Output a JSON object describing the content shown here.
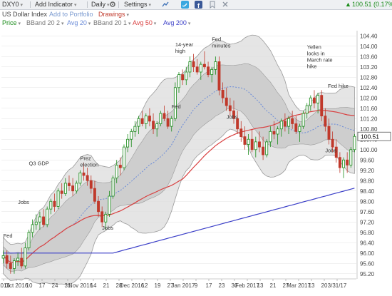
{
  "toolbar": {
    "symbol": "DXY0",
    "add_indicator": "Add Indicator",
    "period": "Daily",
    "settings": "Settings",
    "status_value": "100.51 (0.17%)"
  },
  "subbar": {
    "instrument_name": "US Dollar Index",
    "add_to_portfolio": "Add to Portfolio",
    "drawings": "Drawings"
  },
  "legend": {
    "price": "Price",
    "bband_20_2_upper": "BBand 20 2",
    "avg_20": "Avg 20",
    "bband_20_1": "BBand 20 1",
    "avg_50": "Avg 50",
    "avg_200": "Avg 200"
  },
  "colors": {
    "up": "#1a8c1a",
    "down": "#c0392b",
    "avg20": "#6a8bd8",
    "avg50": "#d94040",
    "avg200": "#3b3fc8",
    "band_outer": "#dcdcdc",
    "band_inner": "#c8c8c8"
  },
  "icons": [
    "dropdown-arrow-icon",
    "settings-gear-icon",
    "twitter-icon",
    "facebook-icon",
    "bookmark-icon",
    "close-icon",
    "up-arrow-icon"
  ],
  "chart_data": {
    "type": "candlestick",
    "title": "",
    "ylim": [
      95.0,
      104.6
    ],
    "y_ticks": [
      "104.40",
      "104.00",
      "103.60",
      "103.20",
      "102.80",
      "102.40",
      "102.00",
      "101.60",
      "101.20",
      "100.80",
      "100.40",
      "100.00",
      "99.60",
      "99.20",
      "98.80",
      "98.40",
      "98.00",
      "97.60",
      "97.20",
      "96.80",
      "96.40",
      "96.00",
      "95.60",
      "95.20"
    ],
    "x_ticks": [
      "2016",
      "Oct 2016",
      "10",
      "17",
      "24",
      "31",
      "Nov 2016",
      "14",
      "21",
      "28",
      "Dec 2016",
      "12",
      "19",
      "27",
      "Jan 2017",
      "9",
      "17",
      "23",
      "30",
      "Feb 2017",
      "13",
      "21",
      "27",
      "Mar 2017",
      "13",
      "20",
      "3/31/17"
    ],
    "last_price": "100.51",
    "ohlc": [
      [
        95.8,
        96.1,
        95.6,
        95.9
      ],
      [
        95.9,
        96.1,
        95.4,
        95.6
      ],
      [
        95.6,
        95.9,
        95.2,
        95.4
      ],
      [
        95.4,
        95.8,
        95.2,
        95.7
      ],
      [
        95.7,
        96.0,
        95.5,
        95.8
      ],
      [
        95.8,
        96.2,
        95.4,
        95.5
      ],
      [
        95.5,
        96.4,
        95.4,
        96.2
      ],
      [
        96.2,
        96.9,
        96.1,
        96.8
      ],
      [
        96.8,
        97.3,
        96.6,
        97.1
      ],
      [
        97.1,
        97.5,
        96.9,
        97.2
      ],
      [
        97.2,
        97.6,
        96.9,
        97.4
      ],
      [
        97.4,
        97.7,
        97.0,
        97.1
      ],
      [
        97.1,
        97.8,
        97.0,
        97.7
      ],
      [
        97.7,
        98.1,
        97.5,
        98.0
      ],
      [
        98.0,
        98.3,
        97.6,
        97.8
      ],
      [
        97.8,
        98.5,
        97.7,
        98.4
      ],
      [
        98.4,
        98.7,
        98.1,
        98.3
      ],
      [
        98.3,
        98.9,
        98.2,
        98.7
      ],
      [
        98.7,
        99.0,
        98.4,
        98.6
      ],
      [
        98.6,
        98.9,
        98.2,
        98.4
      ],
      [
        98.4,
        98.8,
        98.3,
        98.7
      ],
      [
        98.7,
        99.2,
        98.6,
        99.1
      ],
      [
        99.1,
        99.5,
        98.8,
        99.0
      ],
      [
        99.0,
        99.3,
        98.6,
        98.8
      ],
      [
        98.8,
        99.0,
        98.3,
        98.5
      ],
      [
        98.5,
        98.8,
        97.9,
        98.0
      ],
      [
        98.0,
        98.2,
        97.4,
        97.6
      ],
      [
        97.6,
        97.8,
        97.0,
        97.2
      ],
      [
        97.2,
        97.6,
        96.9,
        97.5
      ],
      [
        97.5,
        98.4,
        97.4,
        98.2
      ],
      [
        98.2,
        99.0,
        98.1,
        98.9
      ],
      [
        98.9,
        99.6,
        98.7,
        99.4
      ],
      [
        99.4,
        99.7,
        99.0,
        99.3
      ],
      [
        99.3,
        100.2,
        99.2,
        100.1
      ],
      [
        100.1,
        100.6,
        99.9,
        100.4
      ],
      [
        100.4,
        100.8,
        100.1,
        100.7
      ],
      [
        100.7,
        101.1,
        100.5,
        100.9
      ],
      [
        100.9,
        101.3,
        100.6,
        101.2
      ],
      [
        101.2,
        101.5,
        100.9,
        101.0
      ],
      [
        101.0,
        101.4,
        100.8,
        101.3
      ],
      [
        101.3,
        101.6,
        100.9,
        101.1
      ],
      [
        101.1,
        101.4,
        100.6,
        100.8
      ],
      [
        100.8,
        101.1,
        100.5,
        101.0
      ],
      [
        101.0,
        101.5,
        100.9,
        101.4
      ],
      [
        101.4,
        101.7,
        101.1,
        101.2
      ],
      [
        101.2,
        101.5,
        100.8,
        100.9
      ],
      [
        100.9,
        101.3,
        100.7,
        101.2
      ],
      [
        101.2,
        102.6,
        101.1,
        102.4
      ],
      [
        102.4,
        103.0,
        102.2,
        102.9
      ],
      [
        102.9,
        103.1,
        102.5,
        102.7
      ],
      [
        102.7,
        103.2,
        102.5,
        103.0
      ],
      [
        103.0,
        103.6,
        102.8,
        103.4
      ],
      [
        103.4,
        103.7,
        103.0,
        103.2
      ],
      [
        103.2,
        103.5,
        102.9,
        103.0
      ],
      [
        103.0,
        103.4,
        102.7,
        103.3
      ],
      [
        103.3,
        103.8,
        103.1,
        103.2
      ],
      [
        103.2,
        103.4,
        102.8,
        102.9
      ],
      [
        102.9,
        103.2,
        102.6,
        103.1
      ],
      [
        103.1,
        103.6,
        102.9,
        103.4
      ],
      [
        103.4,
        103.6,
        102.1,
        102.3
      ],
      [
        102.3,
        102.6,
        101.8,
        102.0
      ],
      [
        102.0,
        102.4,
        101.5,
        101.7
      ],
      [
        101.7,
        102.0,
        101.3,
        101.5
      ],
      [
        101.5,
        101.9,
        101.0,
        101.2
      ],
      [
        101.2,
        101.5,
        100.6,
        100.8
      ],
      [
        100.8,
        101.1,
        100.3,
        100.5
      ],
      [
        100.5,
        100.9,
        100.0,
        100.2
      ],
      [
        100.2,
        100.6,
        99.8,
        100.4
      ],
      [
        100.4,
        100.8,
        99.9,
        100.0
      ],
      [
        100.0,
        100.5,
        99.7,
        100.3
      ],
      [
        100.3,
        100.7,
        99.9,
        100.1
      ],
      [
        100.1,
        100.5,
        99.6,
        99.8
      ],
      [
        99.8,
        100.4,
        99.7,
        100.3
      ],
      [
        100.3,
        100.9,
        100.1,
        100.7
      ],
      [
        100.7,
        101.1,
        100.4,
        100.6
      ],
      [
        100.6,
        100.9,
        100.2,
        100.8
      ],
      [
        100.8,
        101.2,
        100.5,
        101.1
      ],
      [
        101.1,
        101.4,
        100.7,
        100.9
      ],
      [
        100.9,
        101.3,
        100.6,
        101.2
      ],
      [
        101.2,
        101.5,
        100.8,
        101.0
      ],
      [
        101.0,
        101.3,
        100.6,
        100.7
      ],
      [
        100.7,
        101.0,
        100.3,
        100.9
      ],
      [
        100.9,
        101.5,
        100.8,
        101.4
      ],
      [
        101.4,
        101.8,
        101.2,
        101.7
      ],
      [
        101.7,
        102.1,
        101.5,
        102.0
      ],
      [
        102.0,
        102.3,
        101.6,
        101.8
      ],
      [
        101.8,
        102.2,
        101.4,
        102.1
      ],
      [
        102.1,
        102.3,
        101.1,
        101.3
      ],
      [
        101.3,
        101.6,
        100.7,
        100.9
      ],
      [
        100.9,
        101.2,
        100.2,
        100.4
      ],
      [
        100.4,
        100.7,
        99.9,
        100.1
      ],
      [
        100.1,
        100.4,
        99.5,
        99.7
      ],
      [
        99.7,
        99.9,
        99.1,
        99.3
      ],
      [
        99.3,
        99.7,
        98.9,
        99.6
      ],
      [
        99.6,
        99.9,
        99.1,
        99.4
      ],
      [
        99.4,
        100.1,
        99.3,
        100.0
      ],
      [
        100.0,
        100.6,
        99.9,
        100.51
      ]
    ],
    "annotations": [
      "Fed",
      "Q3 GDP",
      "Prez election",
      "Jobs",
      "Jobs",
      "14-year high",
      "Fed minutes",
      "Fed",
      "Jobs",
      "Yellen locks in March rate hike",
      "Jobs",
      "Fed hike"
    ]
  }
}
